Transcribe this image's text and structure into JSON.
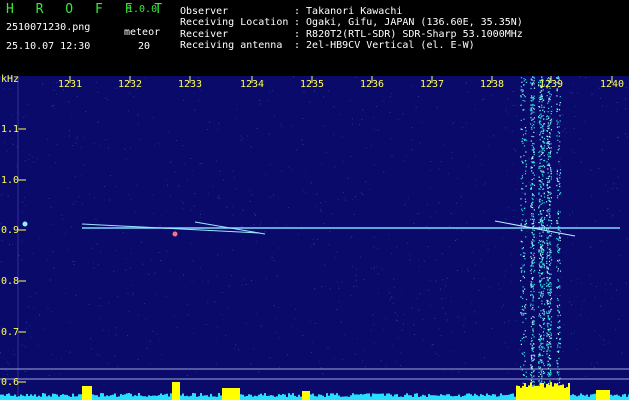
{
  "header": {
    "app_title": "H R O F F T",
    "version": "1.0.0",
    "filename": "2510071230.png",
    "meteor_label": "meteor",
    "datetime": "25.10.07 12:30",
    "meteor_count": "20"
  },
  "info": [
    {
      "key": "Observer",
      "value": ": Takanori Kawachi"
    },
    {
      "key": "Receiving Location",
      "value": ": Ogaki, Gifu, JAPAN (136.60E, 35.35N)"
    },
    {
      "key": "Receiver",
      "value": ": R820T2(RTL-SDR) SDR-Sharp 53.1000MHz"
    },
    {
      "key": "Receiving antenna",
      "value": ": 2el-HB9CV Vertical (el. E-W)"
    }
  ],
  "plot": {
    "y_unit": "kHz",
    "x_ticks": [
      "1231",
      "1232",
      "1233",
      "1234",
      "1235",
      "1236",
      "1237",
      "1238",
      "1239",
      "1240"
    ],
    "y_ticks": [
      "1.1",
      "1.0",
      "0.9",
      "0.8",
      "0.7",
      "0.6"
    ],
    "colors": {
      "background": "#0a0a6a",
      "label": "#ffff55",
      "signal": "#7fd8ff",
      "meteor_band": "#2fe0e0",
      "amplitude_bar": "#ffff00"
    }
  }
}
